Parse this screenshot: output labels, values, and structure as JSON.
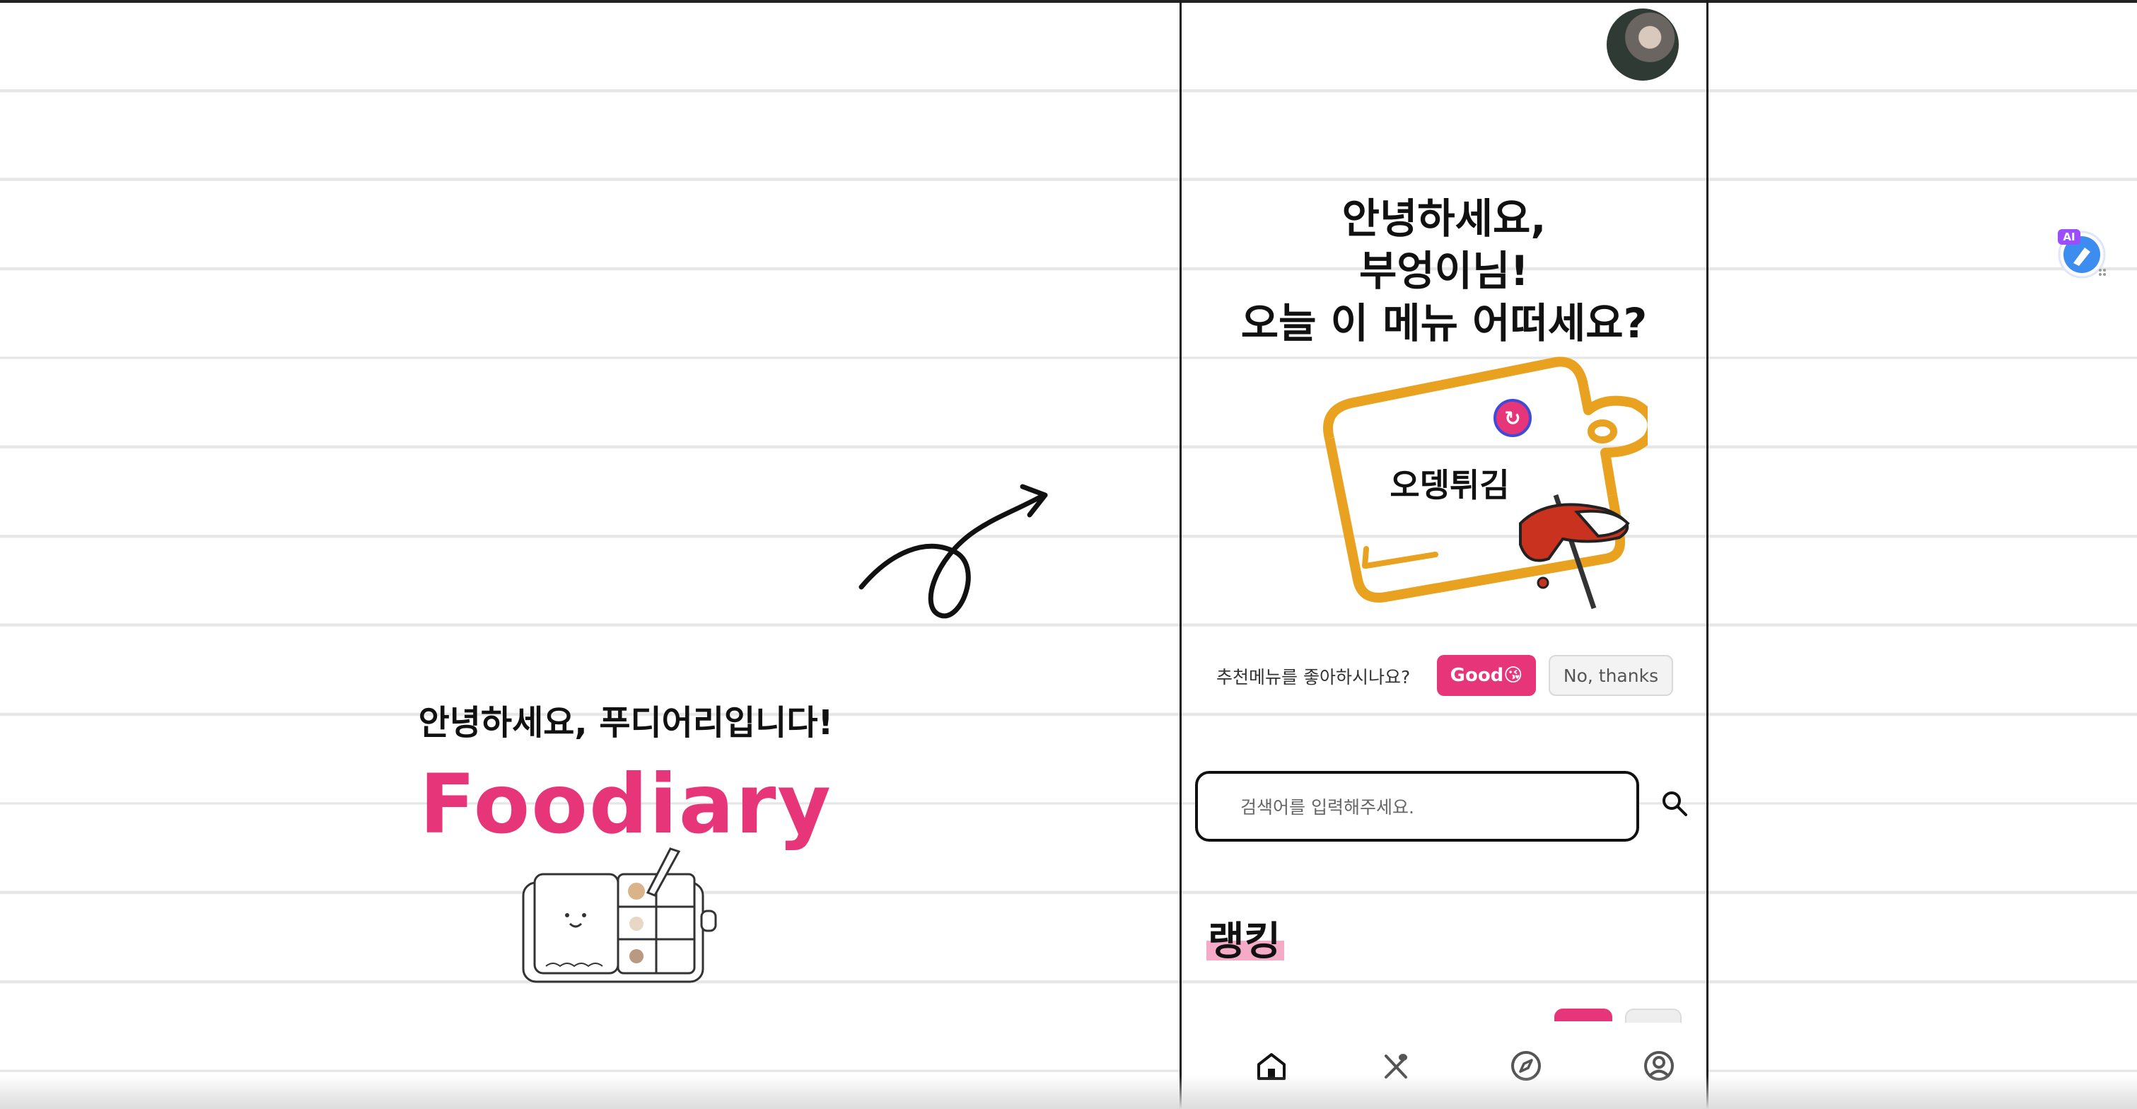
{
  "intro": {
    "greeting": "안녕하세요, 푸디어리입니다!",
    "brand": "Foodiary"
  },
  "app": {
    "hero_lines": [
      "안녕하세요,",
      "부엉이님!",
      "오늘 이 메뉴 어떠세요?"
    ],
    "recommended_menu": "오뎅튀김",
    "feedback": {
      "question": "추천메뉴를 좋아하시나요?",
      "good_label": "Good😘",
      "no_label": "No, thanks"
    },
    "search": {
      "placeholder": "검색어를 입력해주세요."
    },
    "ranking_title": "랭킹",
    "nav": [
      "home-icon",
      "utensils-icon",
      "compass-icon",
      "profile-icon"
    ]
  },
  "widget": {
    "badge": "AI"
  },
  "colors": {
    "brand_pink": "#e7357a",
    "board_orange": "#e8a21f",
    "sauce_red": "#c9321e"
  }
}
